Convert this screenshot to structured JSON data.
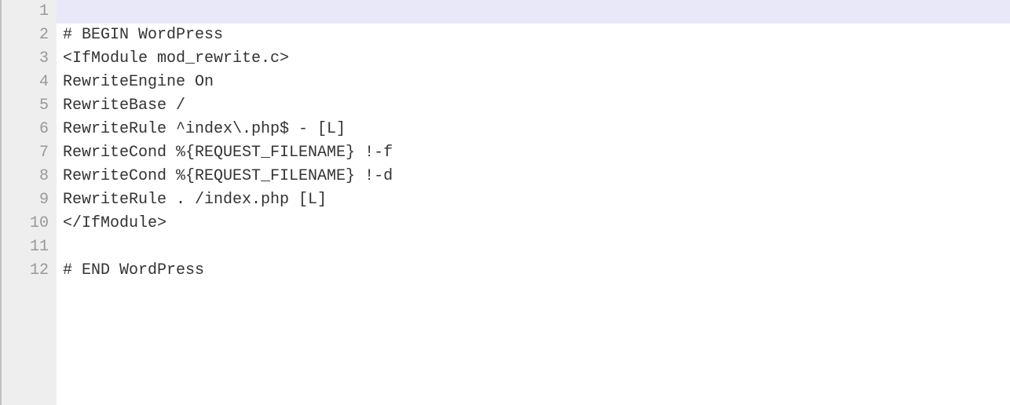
{
  "editor": {
    "highlighted_line_index": 0,
    "lines": [
      {
        "num": "1",
        "text": ""
      },
      {
        "num": "2",
        "text": "# BEGIN WordPress"
      },
      {
        "num": "3",
        "text": "<IfModule mod_rewrite.c>"
      },
      {
        "num": "4",
        "text": "RewriteEngine On"
      },
      {
        "num": "5",
        "text": "RewriteBase /"
      },
      {
        "num": "6",
        "text": "RewriteRule ^index\\.php$ - [L]"
      },
      {
        "num": "7",
        "text": "RewriteCond %{REQUEST_FILENAME} !-f"
      },
      {
        "num": "8",
        "text": "RewriteCond %{REQUEST_FILENAME} !-d"
      },
      {
        "num": "9",
        "text": "RewriteRule . /index.php [L]"
      },
      {
        "num": "10",
        "text": "</IfModule>"
      },
      {
        "num": "11",
        "text": ""
      },
      {
        "num": "12",
        "text": "# END WordPress"
      }
    ]
  }
}
